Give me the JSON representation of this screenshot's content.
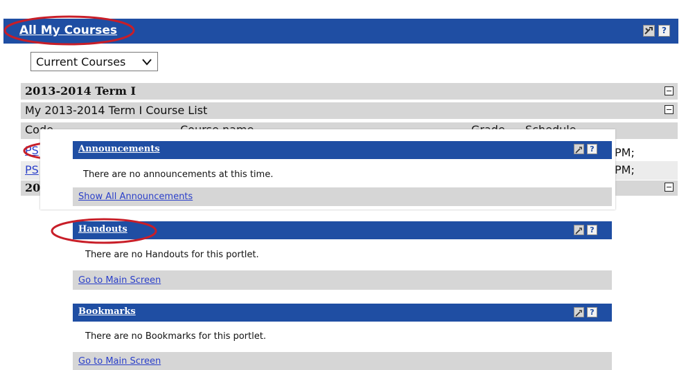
{
  "main": {
    "title": "All My Courses",
    "dropdown_value": "Current Courses",
    "term1_header": "2013-2014 Term I",
    "term1_list_title": "My 2013-2014 Term I Course List",
    "col_code": "Code",
    "col_course_name": "Course name",
    "col_grade": "Grade",
    "col_schedule": "Schedule",
    "row1_code_visible": "PS",
    "row2_code_visible": "PS",
    "row1_schedule_visible": "PM;",
    "row2_schedule_visible": "PM;",
    "term2_header_visible": "20"
  },
  "announcements": {
    "title": "Announcements",
    "message": "There are no announcements at this time.",
    "footer_link": "Show All Announcements"
  },
  "handouts": {
    "title": "Handouts",
    "message": "There are no Handouts for this portlet.",
    "footer_link": "Go to Main Screen"
  },
  "bookmarks": {
    "title": "Bookmarks",
    "message": "There are no Bookmarks for this portlet.",
    "footer_link": "Go to Main Screen"
  },
  "icons": {
    "settings": "wrench-icon",
    "help": "?"
  },
  "colors": {
    "header_blue": "#1f4ea3",
    "highlight_red": "#c81e28",
    "row_gray": "#d6d6d6",
    "link_blue": "#2a3fc9"
  }
}
